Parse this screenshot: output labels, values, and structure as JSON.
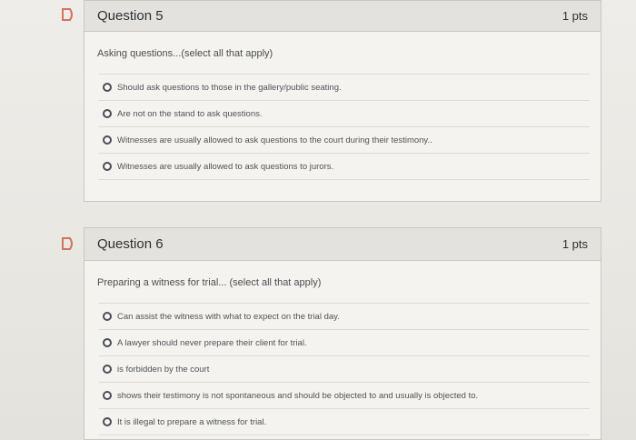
{
  "questions": [
    {
      "title": "Question 5",
      "points": "1 pts",
      "prompt": "Asking questions...(select all that apply)",
      "answers": [
        "Should ask questions to those in the gallery/public seating.",
        "Are not on the stand to ask questions.",
        "Witnesses are usually allowed to ask questions to the court during their testimony..",
        "Witnesses are usually allowed to ask questions to jurors."
      ]
    },
    {
      "title": "Question 6",
      "points": "1 pts",
      "prompt": "Preparing a witness for trial... (select all that apply)",
      "answers": [
        "Can assist the witness with what to expect on the trial day.",
        "A lawyer should never prepare their client for trial.",
        "is forbidden by the court",
        "shows their testimony is not spontaneous and should be objected to and usually is objected to.",
        "It is illegal to prepare a witness for trial."
      ]
    }
  ],
  "icons": {
    "flag": "flag-icon"
  },
  "colors": {
    "flag": "#d4735a",
    "header": "#e3e2de",
    "panel": "#f4f3f0"
  }
}
